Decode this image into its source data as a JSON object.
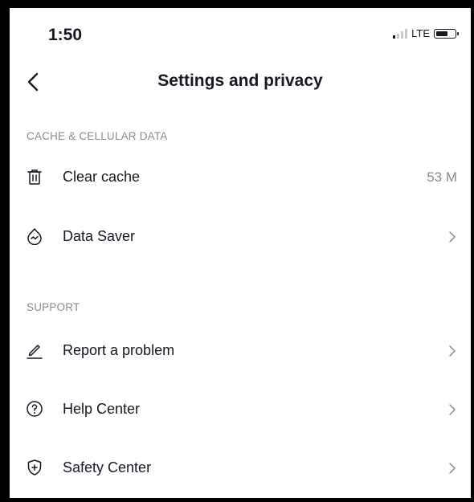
{
  "status_bar": {
    "time": "1:50",
    "network": "LTE"
  },
  "header": {
    "title": "Settings and privacy"
  },
  "sections": [
    {
      "title": "CACHE & CELLULAR DATA",
      "items": [
        {
          "label": "Clear cache",
          "value": "53 M",
          "icon": "trash-icon"
        },
        {
          "label": "Data Saver",
          "icon": "data-saver-icon"
        }
      ]
    },
    {
      "title": "SUPPORT",
      "items": [
        {
          "label": "Report a problem",
          "icon": "pencil-icon"
        },
        {
          "label": "Help Center",
          "icon": "help-icon"
        },
        {
          "label": "Safety Center",
          "icon": "shield-icon"
        }
      ]
    }
  ]
}
